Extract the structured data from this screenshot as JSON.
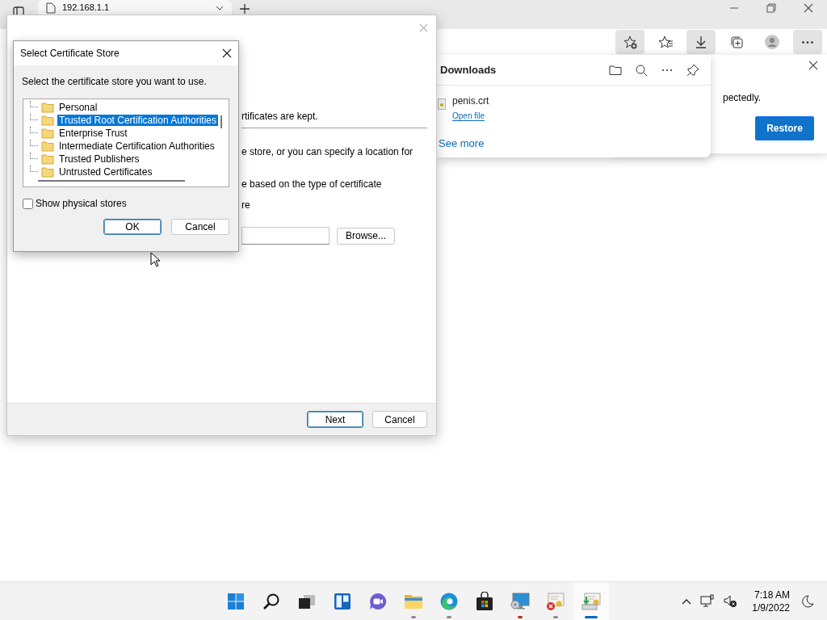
{
  "browser": {
    "tab": {
      "title": "192.168.1.1"
    },
    "toolbar": [
      {
        "kind": "add-favorite",
        "highlighted": true
      },
      {
        "kind": "favorites",
        "highlighted": false
      },
      {
        "kind": "downloads",
        "highlighted": true
      },
      {
        "kind": "collections",
        "highlighted": false
      },
      {
        "kind": "profile",
        "highlighted": false
      },
      {
        "kind": "more",
        "highlighted": true
      }
    ],
    "downloads_panel": {
      "title": "Downloads",
      "items": [
        {
          "file": "penis.crt",
          "action": "Open file"
        }
      ],
      "see_more": "See more"
    },
    "restore_notice": {
      "text": "pectedly.",
      "button": "Restore"
    }
  },
  "wizard": {
    "fragments": [
      "rtificates are kept.",
      "e store, or you can specify a location for",
      "e based on the type of certificate",
      "re"
    ],
    "browse": "Browse...",
    "buttons": [
      {
        "label": "Next",
        "selected": true
      },
      {
        "label": "Cancel",
        "selected": false
      }
    ]
  },
  "dialog": {
    "title": "Select Certificate Store",
    "prompt": "Select the certificate store you want to use.",
    "stores": [
      {
        "label": "Personal",
        "selected": false
      },
      {
        "label": "Trusted Root Certification Authorities",
        "selected": true
      },
      {
        "label": "Enterprise Trust",
        "selected": false
      },
      {
        "label": "Intermediate Certification Authorities",
        "selected": false
      },
      {
        "label": "Trusted Publishers",
        "selected": false
      },
      {
        "label": "Untrusted Certificates",
        "selected": false
      }
    ],
    "show_physical": {
      "label": "Show physical stores",
      "checked": false
    },
    "buttons": [
      {
        "label": "OK",
        "selected": true
      },
      {
        "label": "Cancel",
        "selected": false
      }
    ]
  },
  "taskbar": {
    "apps": [
      {
        "kind": "start",
        "running": false,
        "active": false,
        "attention": false
      },
      {
        "kind": "search",
        "running": false,
        "active": false,
        "attention": false
      },
      {
        "kind": "taskview",
        "running": false,
        "active": false,
        "attention": false
      },
      {
        "kind": "widgets",
        "running": false,
        "active": false,
        "attention": false
      },
      {
        "kind": "chat",
        "running": false,
        "active": false,
        "attention": false
      },
      {
        "kind": "explorer",
        "running": true,
        "active": false,
        "attention": false
      },
      {
        "kind": "edge",
        "running": true,
        "active": false,
        "attention": false
      },
      {
        "kind": "store",
        "running": false,
        "active": false,
        "attention": false
      },
      {
        "kind": "remote",
        "running": true,
        "active": false,
        "attention": true
      },
      {
        "kind": "certerror",
        "running": true,
        "active": false,
        "attention": false
      },
      {
        "kind": "certwizard",
        "running": true,
        "active": true,
        "attention": false
      }
    ],
    "time": "7:18 AM",
    "date": "1/9/2022"
  }
}
